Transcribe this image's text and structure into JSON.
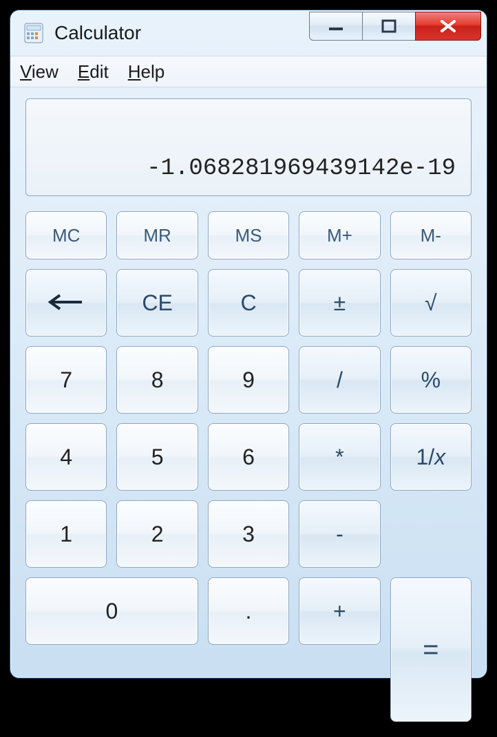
{
  "window": {
    "title": "Calculator"
  },
  "menu": {
    "view": "View",
    "edit": "Edit",
    "help": "Help"
  },
  "display": {
    "value": "-1.068281969439142e-19"
  },
  "buttons": {
    "mc": "MC",
    "mr": "MR",
    "ms": "MS",
    "mplus": "M+",
    "mminus": "M-",
    "backspace": "←",
    "ce": "CE",
    "c": "C",
    "plusminus": "±",
    "sqrt": "√",
    "n7": "7",
    "n8": "8",
    "n9": "9",
    "divide": "/",
    "percent": "%",
    "n4": "4",
    "n5": "5",
    "n6": "6",
    "multiply": "*",
    "reciprocal": "1/x",
    "n1": "1",
    "n2": "2",
    "n3": "3",
    "minus": "-",
    "equals": "=",
    "n0": "0",
    "decimal": ".",
    "plus": "+"
  }
}
